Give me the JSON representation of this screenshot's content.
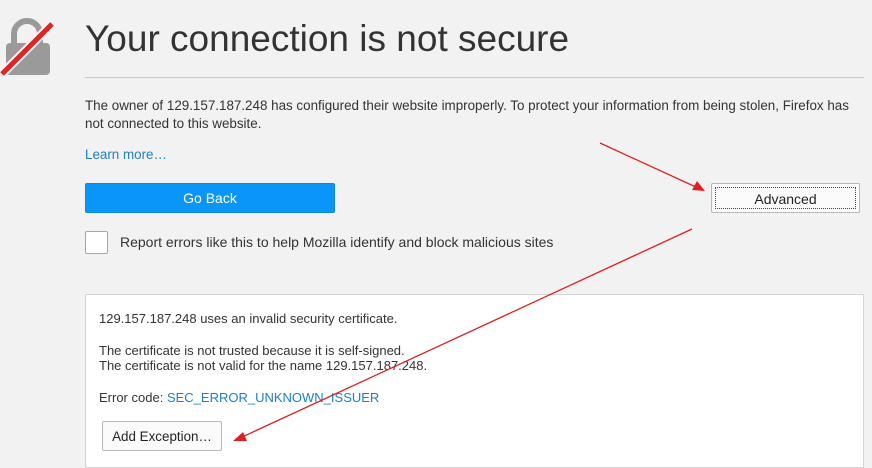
{
  "page": {
    "title": "Your connection is not secure",
    "description": "The owner of 129.157.187.248 has configured their website improperly. To protect your information from being stolen, Firefox has not connected to this website.",
    "learn_more": "Learn more…",
    "go_back_label": "Go Back",
    "advanced_label": "Advanced",
    "report_label": "Report errors like this to help Mozilla identify and block malicious sites",
    "report_checked": false
  },
  "advanced_panel": {
    "invalid_cert": "129.157.187.248 uses an invalid security certificate.",
    "not_trusted": "The certificate is not trusted because it is self-signed.",
    "not_valid_name": "The certificate is not valid for the name 129.157.187.248.",
    "error_code_label": "Error code:",
    "error_code_value": "SEC_ERROR_UNKNOWN_ISSUER",
    "add_exception_label": "Add Exception…"
  },
  "icons": {
    "broken_lock": "broken-lock-icon"
  },
  "colors": {
    "background": "#f2f2f2",
    "primary_button": "#0996f8",
    "link": "#1c7fc9",
    "annotation_arrow": "#e02020",
    "lock_strike": "#d92626",
    "lock_body": "#9a9a9a"
  }
}
